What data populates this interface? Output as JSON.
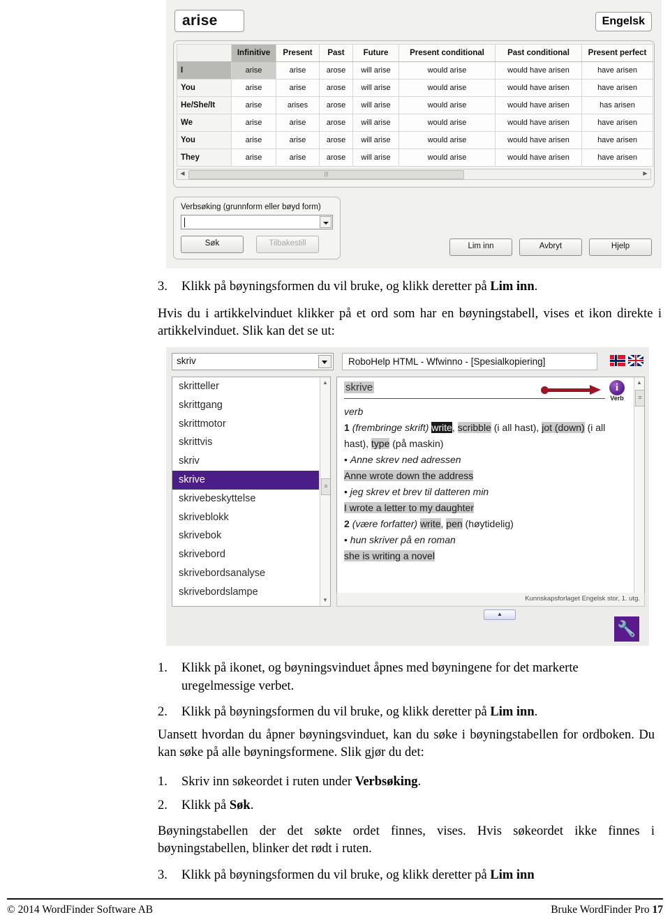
{
  "screenshot1": {
    "headword": "arise",
    "language_button": "Engelsk",
    "table": {
      "columns": [
        "",
        "Infinitive",
        "Present",
        "Past",
        "Future",
        "Present conditional",
        "Past conditional",
        "Present perfect"
      ],
      "selected_column": "Infinitive",
      "selected_row": "I",
      "rows": [
        {
          "person": "I",
          "cells": [
            "arise",
            "arise",
            "arose",
            "will arise",
            "would arise",
            "would have arisen",
            "have arisen"
          ]
        },
        {
          "person": "You",
          "cells": [
            "arise",
            "arise",
            "arose",
            "will arise",
            "would arise",
            "would have arisen",
            "have arisen"
          ]
        },
        {
          "person": "He/She/It",
          "cells": [
            "arise",
            "arises",
            "arose",
            "will arise",
            "would arise",
            "would have arisen",
            "has arisen"
          ]
        },
        {
          "person": "We",
          "cells": [
            "arise",
            "arise",
            "arose",
            "will arise",
            "would arise",
            "would have arisen",
            "have arisen"
          ]
        },
        {
          "person": "You",
          "cells": [
            "arise",
            "arise",
            "arose",
            "will arise",
            "would arise",
            "would have arisen",
            "have arisen"
          ]
        },
        {
          "person": "They",
          "cells": [
            "arise",
            "arise",
            "arose",
            "will arise",
            "would arise",
            "would have arisen",
            "have arisen"
          ]
        }
      ]
    },
    "search_group": {
      "label": "Verbsøking (grunnform eller bøyd form)",
      "input_value": "",
      "search_button": "Søk",
      "reset_button": "Tilbakestill"
    },
    "action_buttons": {
      "paste": "Lim inn",
      "cancel": "Avbryt",
      "help": "Hjelp"
    }
  },
  "text_block_1": {
    "item3_num": "3.",
    "item3_text_a": "Klikk på bøyningsformen du vil bruke, og klikk deretter på ",
    "item3_bold": "Lim inn",
    "item3_text_b": ".",
    "paragraph": "Hvis du i artikkelvinduet klikker på et ord som har en bøyningstabell, vises et ikon direkte i artikkelvinduet. Slik kan det se ut:"
  },
  "screenshot2": {
    "search_combo_value": "skriv",
    "window_title": "RoboHelp HTML - Wfwinno - [Spesialkopiering]",
    "flags": [
      "flag-norway-icon",
      "flag-uk-icon"
    ],
    "word_list": [
      "skritteller",
      "skrittgang",
      "skrittmotor",
      "skrittvis",
      "skriv",
      "skrive",
      "skrivebeskyttelse",
      "skriveblokk",
      "skrivebok",
      "skrivebord",
      "skrivebordsanalyse",
      "skrivebordslampe"
    ],
    "selected_word": "skrive",
    "article": {
      "headword": "skrive",
      "pos": "verb",
      "sense1_num": "1",
      "sense1_gloss": "(frembringe skrift)",
      "sense1_eq_a": "write",
      "sense1_sep_a": ", ",
      "sense1_eq_b": "scribble",
      "sense1_note_b": " (i all hast), ",
      "sense1_eq_c": "jot (down)",
      "sense1_note_c": " (i all hast), ",
      "sense1_eq_d": "type",
      "sense1_note_d": " (på maskin)",
      "ex1_no": "Anne skrev ned adressen",
      "ex1_en": "Anne wrote down the address",
      "ex2_no": "jeg skrev et brev til datteren min",
      "ex2_en": "I wrote a letter to my daughter",
      "sense2_num": "2",
      "sense2_gloss": "(være forfatter)",
      "sense2_eq_a": "write",
      "sense2_sep_a": ", ",
      "sense2_eq_b": "pen",
      "sense2_note_b": " (høytidelig)",
      "ex3_no": "hun skriver på en roman",
      "ex3_en": "she is writing a novel",
      "source": "Kunnskapsforlaget Engelsk stor, 1. utg.",
      "verb_badge_letter": "i",
      "verb_badge_label": "Verb"
    },
    "status_source": "Kunnskapsforlaget Engelsk stor, 1. utg."
  },
  "text_block_2": {
    "item1_num": "1.",
    "item1_text": "Klikk på ikonet, og bøyningsvinduet åpnes med bøyningene for det markerte uregelmessige verbet.",
    "item2_num": "2.",
    "item2_text_a": "Klikk på bøyningsformen du vil bruke, og klikk deretter på ",
    "item2_bold": "Lim inn",
    "item2_text_b": ".",
    "paragraph": "Uansett hvordan du åpner bøyningsvinduet, kan du søke i bøyningstabellen for ordboken. Du kan søke på alle bøyningsformene. Slik gjør du det:"
  },
  "text_block_3": {
    "item1_num": "1.",
    "item1_text_a": "Skriv inn søkeordet i ruten under ",
    "item1_bold": "Verbsøking",
    "item1_text_b": ".",
    "item2_num": "2.",
    "item2_text_a": "Klikk på ",
    "item2_bold": "Søk",
    "item2_text_b": ".",
    "paragraph": "Bøyningstabellen der det søkte ordet finnes, vises. Hvis søkeordet ikke finnes i bøyningstabellen, blinker det rødt i ruten.",
    "item3_num": "3.",
    "item3_text_a": "Klikk på bøyningsformen du vil bruke, og klikk deretter på ",
    "item3_bold": "Lim inn"
  },
  "footer": {
    "left": "© 2014 WordFinder Software AB",
    "right_text": "Bruke WordFinder Pro ",
    "page_number": "17"
  }
}
